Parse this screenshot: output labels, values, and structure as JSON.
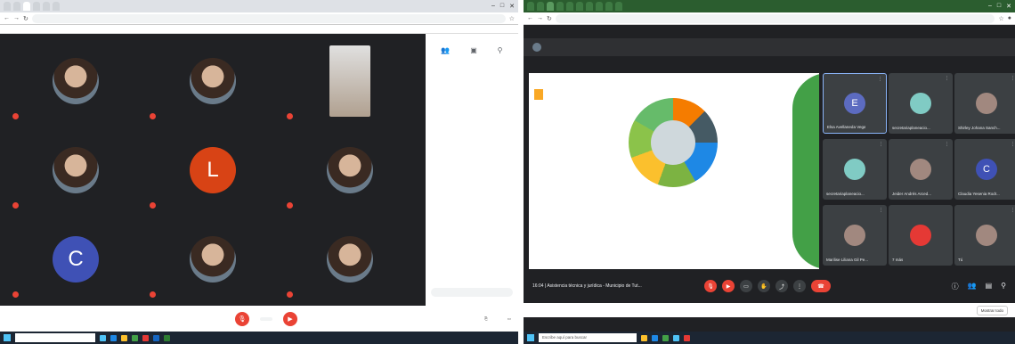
{
  "left_window": {
    "tabs": [
      "",
      "",
      "",
      "",
      "",
      ""
    ],
    "url": "",
    "bookmarks": [],
    "tiles": [
      {
        "initial": "",
        "label": "",
        "kind": "photo"
      },
      {
        "initial": "",
        "label": "",
        "kind": "photo"
      },
      {
        "initial": "",
        "label": "",
        "kind": "photo"
      },
      {
        "initial": "",
        "label": "",
        "kind": "photo"
      },
      {
        "initial": "L",
        "label": "",
        "kind": "initial",
        "color": "#d84315"
      },
      {
        "initial": "",
        "label": "",
        "kind": "photo"
      },
      {
        "initial": "C",
        "label": "",
        "kind": "initial",
        "color": "#3f51b5"
      },
      {
        "initial": "",
        "label": "",
        "kind": "photo"
      },
      {
        "initial": "",
        "label": "",
        "kind": "photo"
      }
    ],
    "sidebar": {
      "title": "",
      "messages": [
        "",
        ""
      ],
      "compose_placeholder": ""
    },
    "meeting_title": "",
    "taskbar_search": "",
    "taskbar_clock": ""
  },
  "right_window": {
    "tabs": [
      "",
      "",
      "",
      "",
      "",
      "",
      "",
      "",
      "",
      ""
    ],
    "url": "",
    "presenter_text": "",
    "slide": {
      "hub_text": "",
      "notes": [
        "",
        "",
        "",
        "",
        "",
        "",
        ""
      ]
    },
    "participants": [
      {
        "initial": "E",
        "name": "Elsa Avellaneda Vega",
        "color": "#5c6bc0",
        "selected": true
      },
      {
        "initial": "",
        "name": "secretariaplaneacio...",
        "color": "#80cbc4"
      },
      {
        "initial": "",
        "name": "Shirley Johana Sanch...",
        "color": "#a1887f"
      },
      {
        "initial": "",
        "name": "secretariaplaneacio...",
        "color": "#80cbc4"
      },
      {
        "initial": "",
        "name": "Jeider Andrés Arced...",
        "color": "#a1887f"
      },
      {
        "initial": "C",
        "name": "Claudia Yesenia Rodr...",
        "color": "#3f51b5"
      },
      {
        "initial": "",
        "name": "Marilise Liliana Gil Pe...",
        "color": "#a1887f"
      },
      {
        "initial": "",
        "name": "7 más",
        "color": "#e53935"
      },
      {
        "initial": "",
        "name": "Tú",
        "color": "#a1887f"
      }
    ],
    "time": "16:04",
    "meeting_title": "Asistencia técnica y jurídica - Municipio de Tut...",
    "downloads": [
      "",
      ""
    ],
    "show_all": "Mostrar todo",
    "taskbar_search": "Escribe aquí para buscar",
    "taskbar_clock": ""
  }
}
